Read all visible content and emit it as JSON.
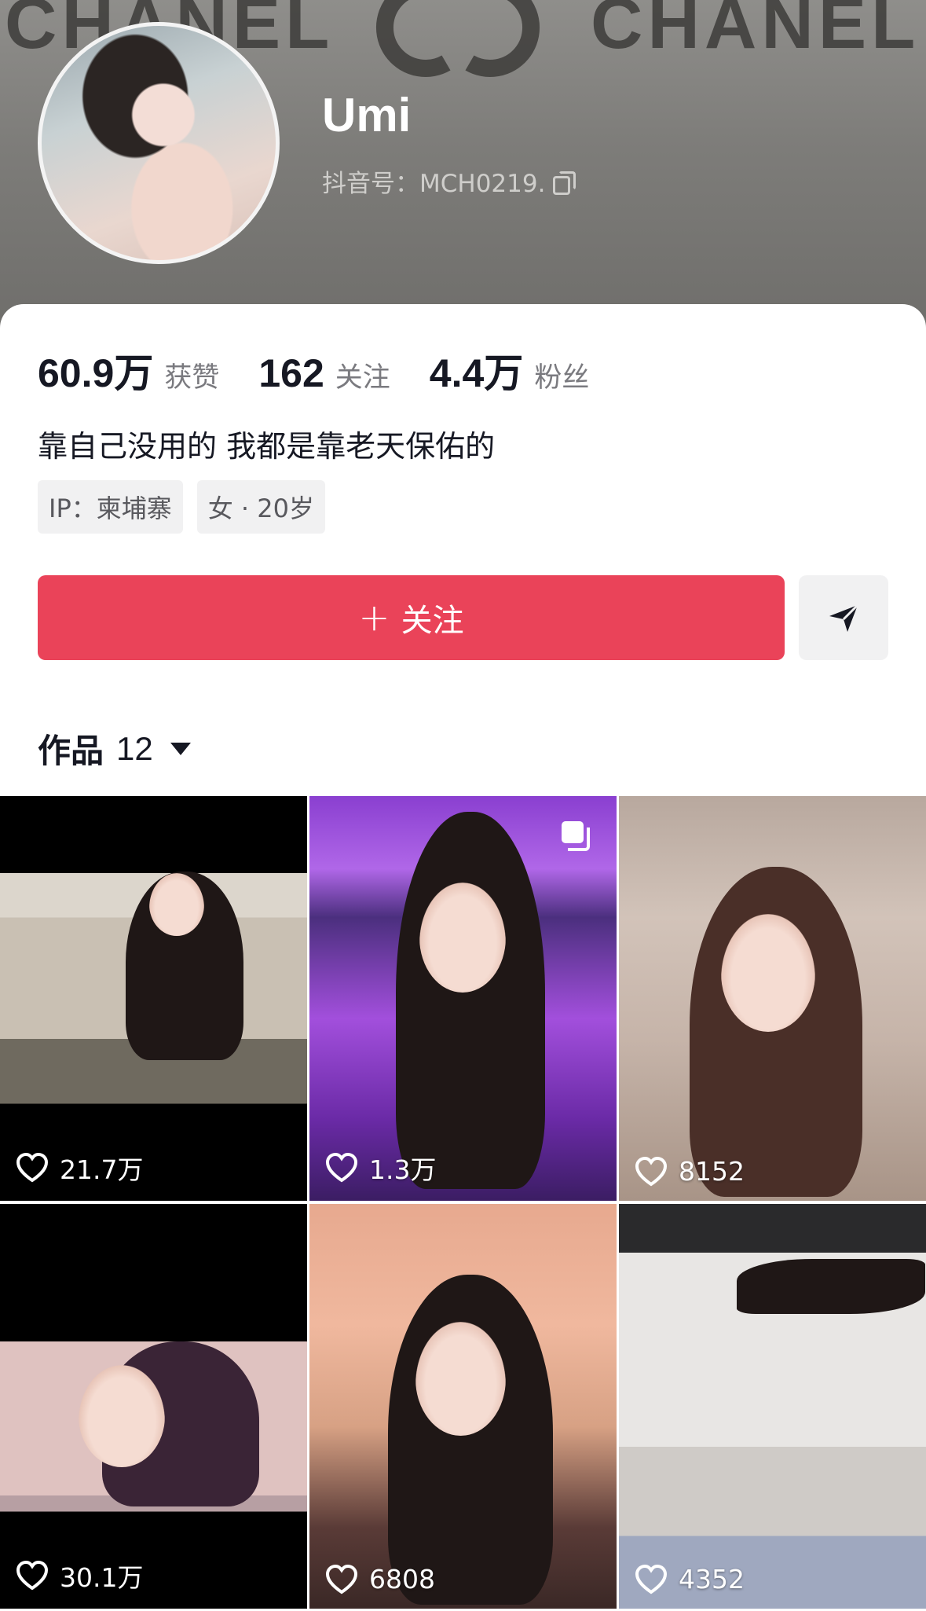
{
  "header": {
    "brand_left": "CHANEL",
    "brand_right": "CHANEL",
    "username": "Umi",
    "douyin_id": "抖音号：MCH0219."
  },
  "stats": [
    {
      "value": "60.9万",
      "label": "获赞"
    },
    {
      "value": "162",
      "label": "关注"
    },
    {
      "value": "4.4万",
      "label": "粉丝"
    }
  ],
  "bio": "靠自己没用的 我都是靠老天保佑的",
  "tags": [
    "IP：柬埔寨",
    "女 · 20岁"
  ],
  "actions": {
    "follow_label": "关注",
    "follow_plus": "+"
  },
  "works": {
    "label": "作品",
    "count": "12"
  },
  "videos": [
    {
      "likes": "21.7万"
    },
    {
      "likes": "1.3万"
    },
    {
      "likes": "8152"
    },
    {
      "likes": "30.1万"
    },
    {
      "likes": "6808"
    },
    {
      "likes": "4352"
    }
  ],
  "colors": {
    "follow_button": "#ea4359",
    "text_primary": "#161823",
    "text_secondary": "#7a7a7f"
  },
  "icons": [
    "copy-icon",
    "share-icon",
    "caret-down-icon",
    "heart-icon",
    "multi-image-icon"
  ]
}
